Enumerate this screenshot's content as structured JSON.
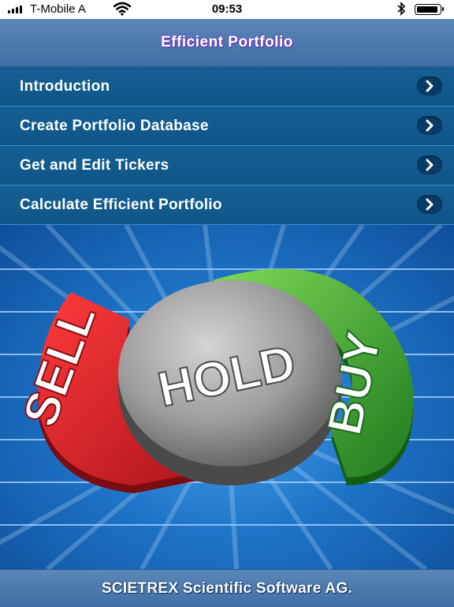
{
  "status_bar": {
    "carrier": "T-Mobile A",
    "time": "09:53"
  },
  "nav": {
    "title": "Efficient Portfolio"
  },
  "menu": {
    "items": [
      {
        "label": "Introduction"
      },
      {
        "label": "Create Portfolio Database"
      },
      {
        "label": "Get and Edit Tickers"
      },
      {
        "label": "Calculate Efficient Portfolio"
      }
    ]
  },
  "hero": {
    "sell_label": "SELL",
    "hold_label": "HOLD",
    "buy_label": "BUY",
    "colors": {
      "sell": "#d71e2a",
      "hold": "#9a9a9a",
      "buy": "#4caf2e",
      "background": "#1e74c8"
    }
  },
  "footer": {
    "text": "SCIETREX Scientific Software AG."
  },
  "icons": {
    "menu_item": "chevron-right-icon",
    "wifi": "wifi-icon",
    "bluetooth": "bluetooth-icon",
    "battery": "battery-icon",
    "signal": "signal-icon"
  }
}
